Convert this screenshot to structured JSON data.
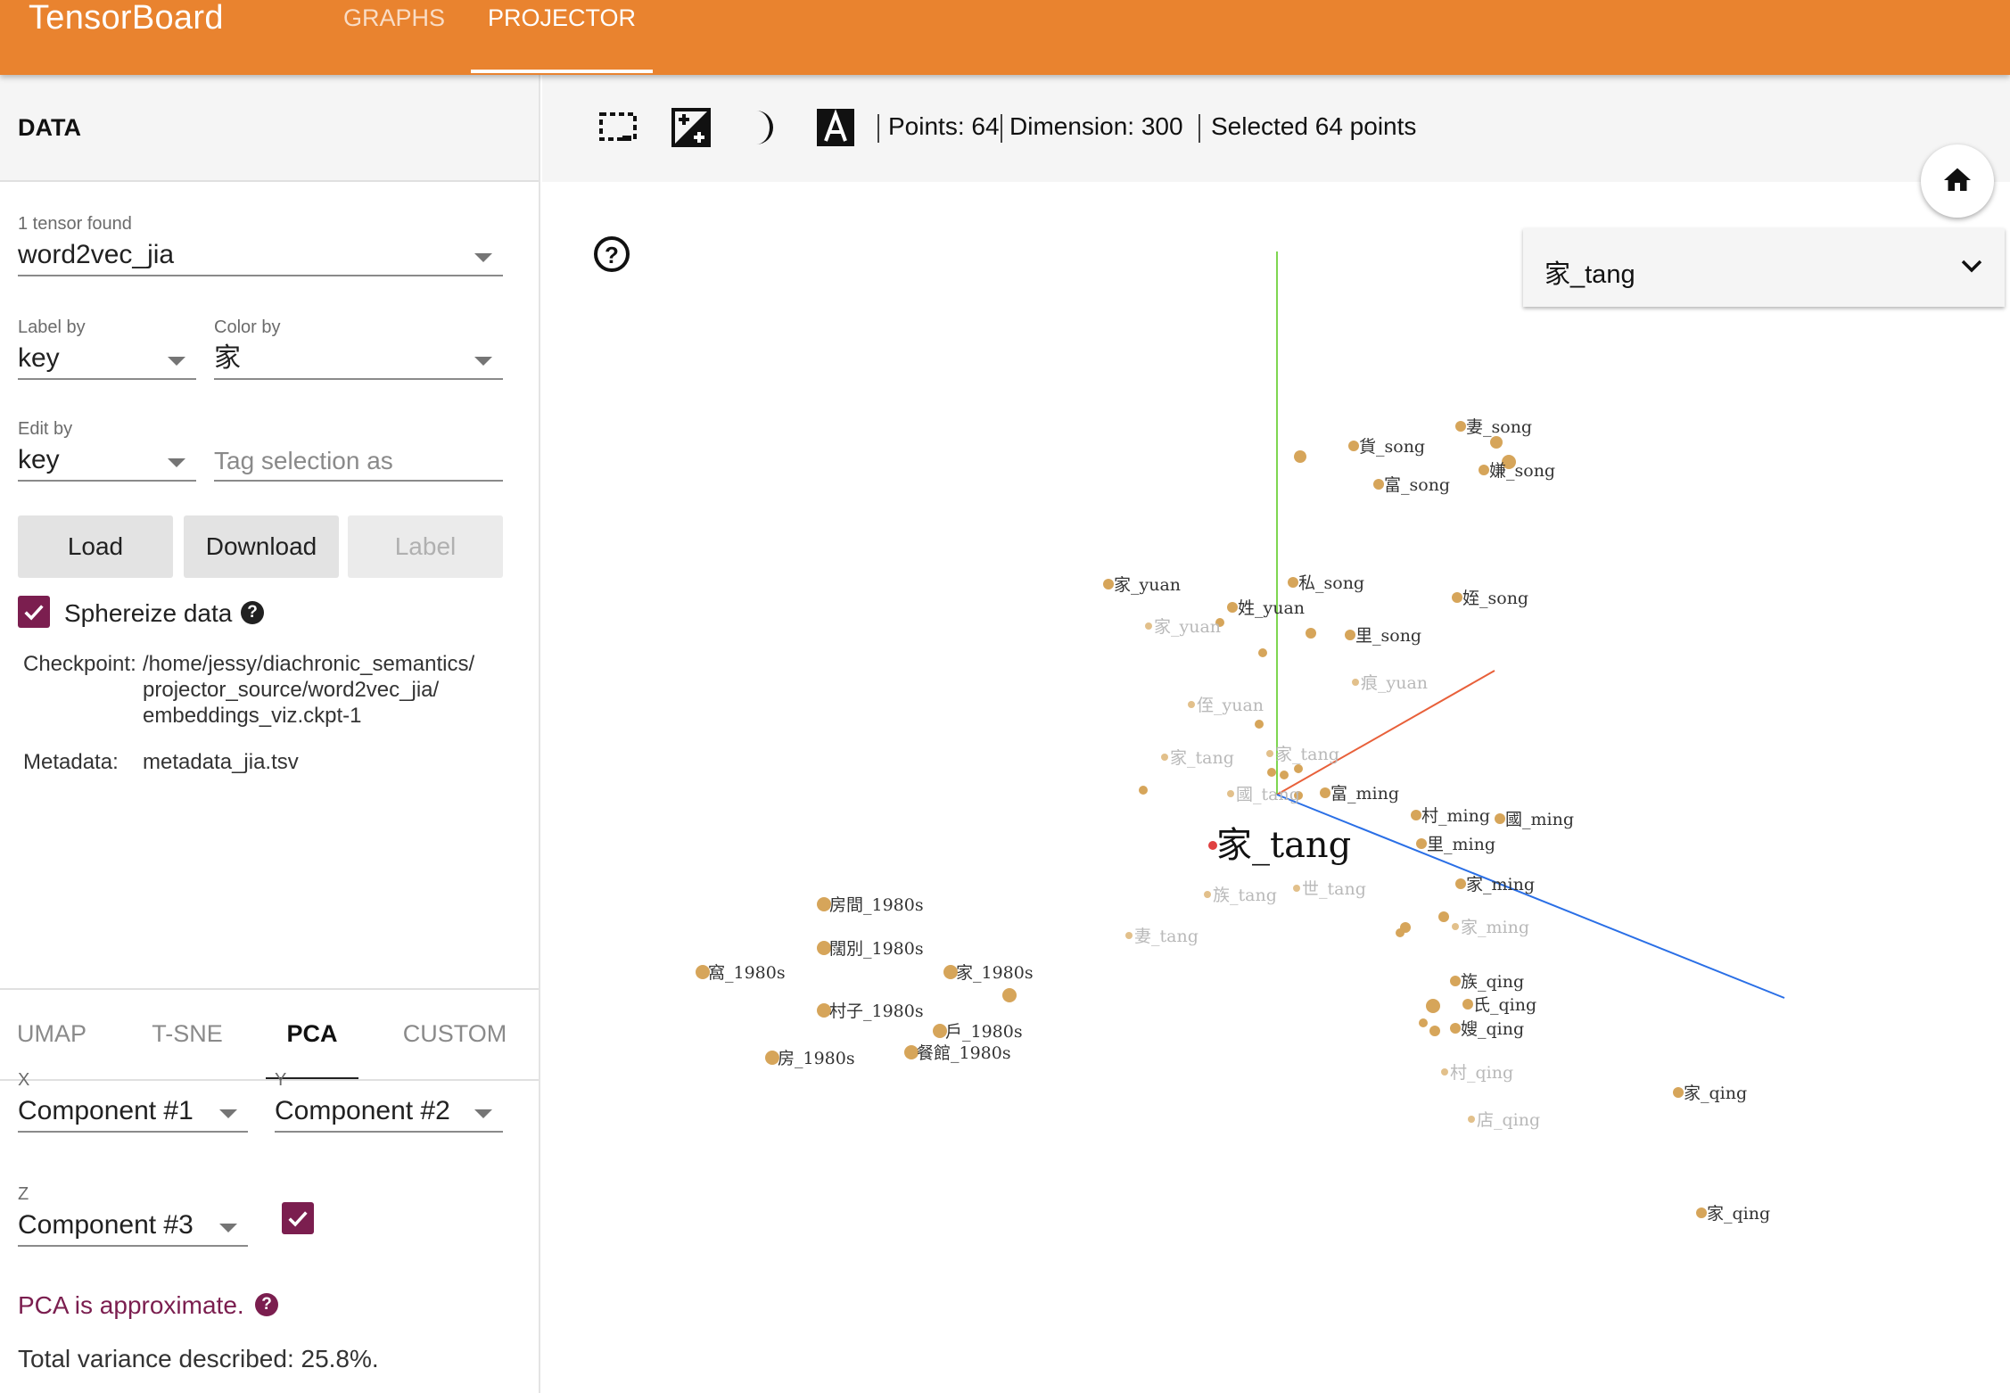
{
  "header": {
    "brand": "TensorBoard",
    "tabs": [
      {
        "label": "GRAPHS",
        "active": false
      },
      {
        "label": "PROJECTOR",
        "active": true
      }
    ],
    "color": "#e9832f"
  },
  "sidebar": {
    "data_title": "DATA",
    "tensor_found": "1 tensor found",
    "tensor_value": "word2vec_jia",
    "label_by": {
      "label": "Label by",
      "value": "key"
    },
    "color_by": {
      "label": "Color by",
      "value": "家"
    },
    "edit_by": {
      "label": "Edit by",
      "value": "key"
    },
    "tag_placeholder": "Tag selection as",
    "buttons": {
      "load": "Load",
      "download": "Download",
      "label": "Label"
    },
    "sphereize_label": "Sphereize data",
    "sphereize_checked": true,
    "checkpoint_label": "Checkpoint:",
    "checkpoint_lines": [
      "/home/jessy/diachronic_semantics/",
      "projector_source/word2vec_jia/",
      "embeddings_viz.ckpt-1"
    ],
    "metadata_label": "Metadata:",
    "metadata_value": "metadata_jia.tsv",
    "projection_tabs": [
      {
        "label": "UMAP",
        "active": false
      },
      {
        "label": "T-SNE",
        "active": false
      },
      {
        "label": "PCA",
        "active": true
      },
      {
        "label": "CUSTOM",
        "active": false
      }
    ],
    "pca": {
      "x_label": "X",
      "x_value": "Component #1",
      "y_label": "Y",
      "y_value": "Component #2",
      "z_label": "Z",
      "z_value": "Component #3",
      "z_checked": true,
      "approx_text": "PCA is approximate.",
      "variance_text": "Total variance described: 25.8%."
    },
    "accent_color": "#7b1e4f"
  },
  "toolbar": {
    "points_text": "Points: 64",
    "dimension_text": "Dimension: 300",
    "selected_text": "Selected 64 points",
    "icons": [
      "select-rectangle-icon",
      "nearest-neighbors-icon",
      "night-mode-icon",
      "labels-toggle-icon"
    ]
  },
  "search": {
    "value": "家_tang"
  },
  "plot": {
    "point_color": "#d6a55a",
    "selected_color": "#e04040",
    "axis_colors": {
      "y": "#7fd650",
      "x": "#e8603a",
      "z": "#2a6fe6"
    },
    "focus_label": "家_tang",
    "labels": [
      {
        "text": "妻_song",
        "faded": false
      },
      {
        "text": "貨_song",
        "faded": false
      },
      {
        "text": "富_song",
        "faded": false
      },
      {
        "text": "嫌_song",
        "faded": false
      },
      {
        "text": "家_yuan",
        "faded": false
      },
      {
        "text": "私_song",
        "faded": false
      },
      {
        "text": "姪_song",
        "faded": false
      },
      {
        "text": "姓_yuan",
        "faded": false
      },
      {
        "text": "家_yuan",
        "faded": true
      },
      {
        "text": "里_song",
        "faded": false
      },
      {
        "text": "痕_yuan",
        "faded": true
      },
      {
        "text": "侄_yuan",
        "faded": true
      },
      {
        "text": "家_tang",
        "faded": true
      },
      {
        "text": "家_tang",
        "faded": true
      },
      {
        "text": "國_tang",
        "faded": true
      },
      {
        "text": "富_ming",
        "faded": false
      },
      {
        "text": "村_ming",
        "faded": false
      },
      {
        "text": "國_ming",
        "faded": false
      },
      {
        "text": "里_ming",
        "faded": false
      },
      {
        "text": "家_ming",
        "faded": false
      },
      {
        "text": "族_tang",
        "faded": true
      },
      {
        "text": "世_tang",
        "faded": true
      },
      {
        "text": "妻_tang",
        "faded": true
      },
      {
        "text": "家_ming",
        "faded": true
      },
      {
        "text": "房間_1980s",
        "faded": false
      },
      {
        "text": "闊別_1980s",
        "faded": false
      },
      {
        "text": "窩_1980s",
        "faded": false
      },
      {
        "text": "家_1980s",
        "faded": false
      },
      {
        "text": "村子_1980s",
        "faded": false
      },
      {
        "text": "戶_1980s",
        "faded": false
      },
      {
        "text": "房_1980s",
        "faded": false
      },
      {
        "text": "餐館_1980s",
        "faded": false
      },
      {
        "text": "族_qing",
        "faded": false
      },
      {
        "text": "氏_qing",
        "faded": false
      },
      {
        "text": "嫂_qing",
        "faded": false
      },
      {
        "text": "村_qing",
        "faded": true
      },
      {
        "text": "家_qing",
        "faded": false
      },
      {
        "text": "店_qing",
        "faded": true
      },
      {
        "text": "家_qing",
        "faded": false
      }
    ]
  }
}
